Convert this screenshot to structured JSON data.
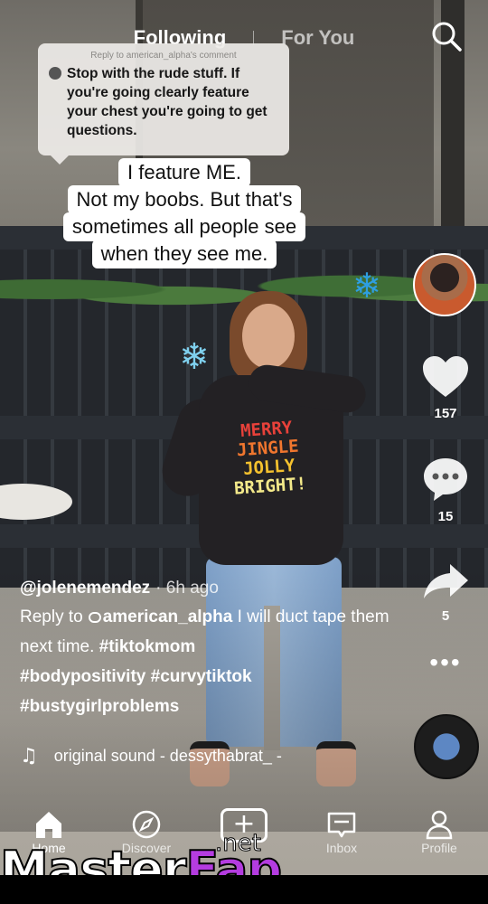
{
  "top_tabs": {
    "following": "Following",
    "for_you": "For You"
  },
  "reply_comment": {
    "label": "Reply to american_alpha's comment",
    "text": "Stop with the rude stuff. If you're going clearly feature your chest you're going to get questions."
  },
  "caption": {
    "lines": [
      "I feature ME.",
      "Not my boobs. But that's",
      "sometimes all people see",
      "when they see me."
    ]
  },
  "shirt": {
    "lines": [
      "MERRY",
      "JINGLE",
      "JOLLY",
      "BRIGHT!"
    ],
    "colors": [
      "#e8413a",
      "#f0762e",
      "#f4c12e",
      "#f3e98a"
    ]
  },
  "actions": {
    "like_count": "157",
    "comment_count": "15",
    "share_count": "5"
  },
  "post": {
    "author": "@jolenemendez",
    "time": "· 6h ago",
    "reply_prefix": "Reply to",
    "mention": "american_alpha",
    "text": "I will duct tape them next time.",
    "hashtags_1": "#tiktokmom",
    "hashtags_2": "#bodypositivity #curvytiktok",
    "hashtags_3": "#bustygirlproblems"
  },
  "sound": {
    "title": "original sound - dessythabrat_ -"
  },
  "bottom_nav": {
    "home": "Home",
    "discover": "Discover",
    "inbox": "Inbox",
    "profile": "Profile"
  },
  "watermark": {
    "master": "Master",
    "fap": "Fap",
    "net": ".net"
  },
  "colors": {
    "watermark_accent": "#b43ce0",
    "icon_white": "#ffffff"
  },
  "icons": [
    "search-icon",
    "heart-icon",
    "comment-icon",
    "share-icon",
    "more-icon",
    "music-note-icon",
    "home-icon",
    "discover-icon",
    "create-icon",
    "inbox-icon",
    "profile-icon"
  ]
}
